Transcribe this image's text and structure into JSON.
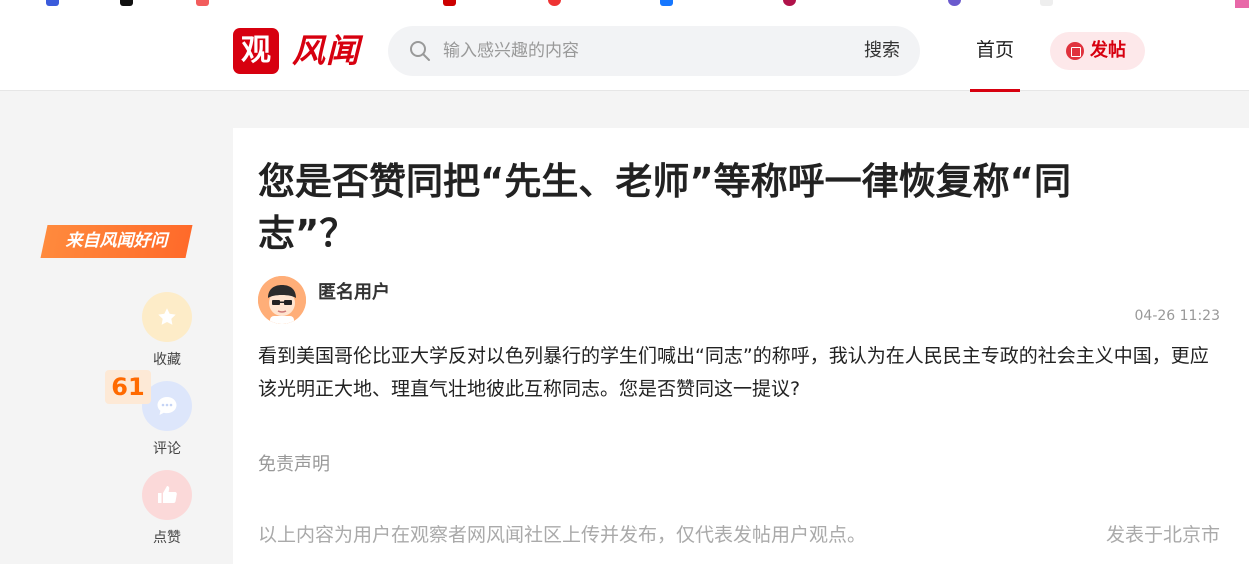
{
  "header": {
    "logo_mark": "观",
    "logo_text": "风闻",
    "search_placeholder": "输入感兴趣的内容",
    "search_button": "搜索",
    "nav_home": "首页",
    "post_button": "发帖"
  },
  "sidebar": {
    "source_badge": "来自风闻好问",
    "favorite_label": "收藏",
    "comment_label": "评论",
    "comment_count": "61",
    "like_label": "点赞"
  },
  "post": {
    "title": "您是否赞同把“先生、老师”等称呼一律恢复称“同志”？",
    "author": "匿名用户",
    "time": "04-26 11:23",
    "content": "看到美国哥伦比亚大学反对以色列暴行的学生们喊出“同志”的称呼，我认为在人民民主专政的社会主义中国，更应该光明正大地、理直气壮地彼此互称同志。您是否赞同这一提议?",
    "disclaimer": "免责声明",
    "footer_note": "以上内容为用户在观察者网风闻社区上传并发布，仅代表发帖用户观点。",
    "location": "发表于北京市"
  },
  "colors": {
    "brand_red": "#d7000f",
    "badge_orange": "#ff6a2a",
    "count_orange": "#ff6a00"
  }
}
